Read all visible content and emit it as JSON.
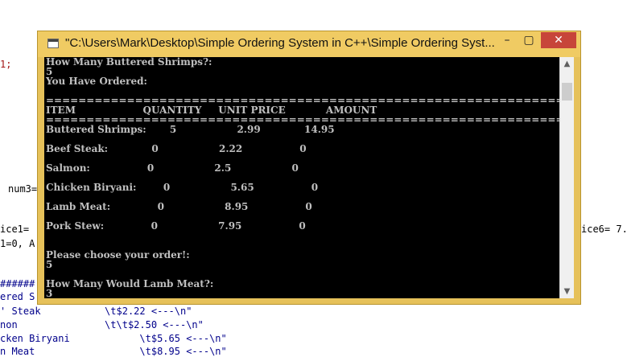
{
  "background_code": {
    "frag1": "1;",
    "frag2": "num3=",
    "frag3": "ice1=",
    "frag4": "1=0, A",
    "frag5": "ice6= 7.",
    "frag6": "######",
    "frag7": "ered S",
    "frag8": "' Steak           \\t$2.22 <---\\n\"",
    "frag9": "non               \\t\\t$2.50 <---\\n\"",
    "frag10": "cken Biryani            \\t$5.65 <---\\n\"",
    "frag11": "n Meat                  \\t$8.95 <---\\n\""
  },
  "window": {
    "title": "\"C:\\Users\\Mark\\Desktop\\Simple Ordering System in C++\\Simple Ordering Syst...",
    "minimize_label": "–",
    "maximize_label": "▢",
    "close_label": "✕",
    "icon": "console-app-icon"
  },
  "console": {
    "lines": [
      "How Many Buttered Shrimps?:",
      "5",
      "You Have Ordered:",
      "",
      "=================================================================",
      "ITEM                    QUANTITY     UNIT PRICE            AMOUNT",
      "=================================================================",
      "Buttered Shrimps:       5                  2.99             14.95",
      "",
      "Beef Steak:             0                  2.22                 0",
      "",
      "Salmon:                 0                  2.5                  0",
      "",
      "Chicken Biryani:        0                  5.65                 0",
      "",
      "Lamb Meat:              0                  8.95                 0",
      "",
      "Pork Stew:              0                  7.95                 0",
      "",
      "",
      "Please choose your order!:",
      "5",
      "",
      "How Many Would Lamb Meat?:",
      "3"
    ]
  },
  "colors": {
    "window_frame": "#e6c15a",
    "close_button": "#c7453a",
    "console_bg": "#000000",
    "console_text": "#c0c0c0",
    "code_blue": "#00008b",
    "code_red": "#a31515"
  }
}
